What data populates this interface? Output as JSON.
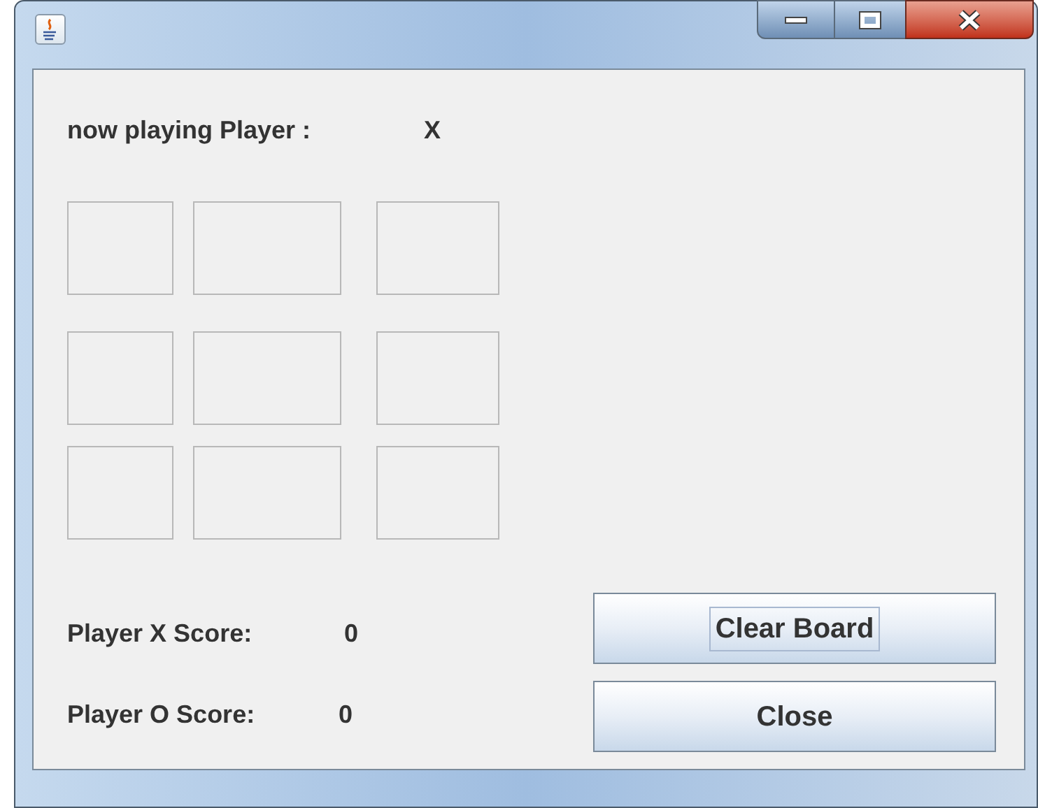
{
  "status": {
    "label": "now playing Player :",
    "value": "X"
  },
  "scores": [
    {
      "label": "Player X Score:",
      "value": "0"
    },
    {
      "label": "Player O Score:",
      "value": "0"
    }
  ],
  "buttons": [
    {
      "label": "Clear Board",
      "focused": true
    },
    {
      "label": "Close",
      "focused": false
    }
  ]
}
